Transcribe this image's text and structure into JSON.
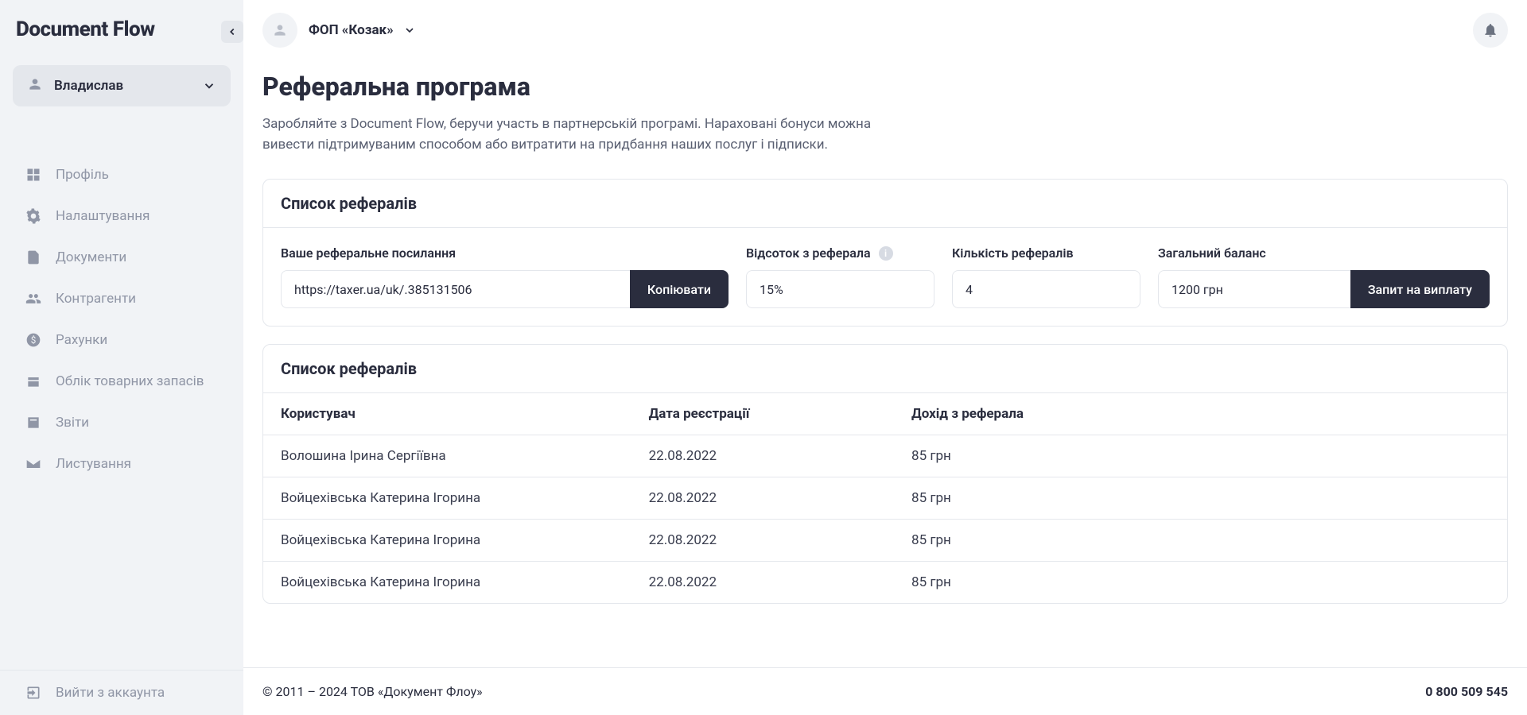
{
  "app": {
    "name": "Document Flow"
  },
  "sidebar": {
    "user_name": "Владислав",
    "nav": [
      {
        "icon": "grid",
        "label": "Профіль"
      },
      {
        "icon": "gear",
        "label": "Налаштування"
      },
      {
        "icon": "doc",
        "label": "Документи"
      },
      {
        "icon": "people",
        "label": "Контрагенти"
      },
      {
        "icon": "dollar",
        "label": "Рахунки"
      },
      {
        "icon": "store",
        "label": "Облік товарних запасів"
      },
      {
        "icon": "report",
        "label": "Звіти"
      },
      {
        "icon": "mail",
        "label": "Листування"
      }
    ],
    "logout_label": "Вийти з аккаунта"
  },
  "header": {
    "org_name": "ФОП «Козак»"
  },
  "page": {
    "title": "Реферальна програма",
    "intro": "Заробляйте з Document Flow, беручи участь в партнерській програмі. Нараховані бонуси можна вивести підтримуваним способом або витратити на придбання наших послуг і підписки."
  },
  "panel1": {
    "title": "Список рефералів",
    "link_label": "Ваше реферальне посилання",
    "link_value": "https://taxer.ua/uk/.385131506",
    "copy_label": "Копіювати",
    "pct_label": "Відсоток з реферала",
    "pct_value": "15%",
    "cnt_label": "Кількість рефералів",
    "cnt_value": "4",
    "bal_label": "Загальний баланс",
    "bal_value": "1200 грн",
    "payout_label": "Запит на виплату"
  },
  "panel2": {
    "title": "Список рефералів",
    "columns": {
      "user": "Користувач",
      "date": "Дата реєстрації",
      "income": "Дохід з реферала"
    },
    "rows": [
      {
        "user": "Волошина Ірина Сергіївна",
        "date": "22.08.2022",
        "income": "85 грн"
      },
      {
        "user": "Войцехівська Катерина Ігорина",
        "date": "22.08.2022",
        "income": "85 грн"
      },
      {
        "user": "Войцехівська Катерина Ігорина",
        "date": "22.08.2022",
        "income": "85 грн"
      },
      {
        "user": "Войцехівська Катерина Ігорина",
        "date": "22.08.2022",
        "income": "85 грн"
      }
    ]
  },
  "footer": {
    "copyright": "© 2011 – 2024 ТОВ «Документ Флоу»",
    "phone": "0 800 509 545"
  }
}
